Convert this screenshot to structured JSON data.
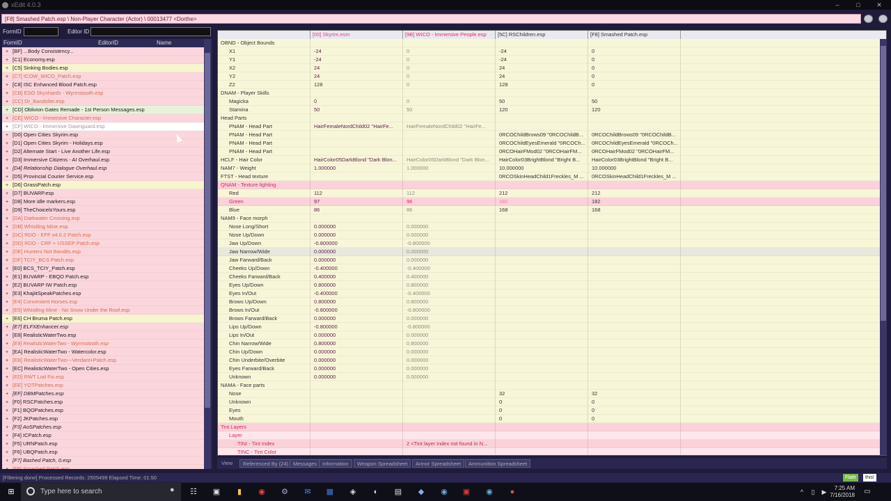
{
  "window": {
    "title": "xEdit 4.0.3",
    "path": "[F8] Smashed Patch.esp \\ Non-Player Character (Actor) \\ 00013477 <Dorthe>"
  },
  "filter": {
    "formid_label": "FormID",
    "editorid_label": "Editor ID"
  },
  "left": {
    "columns": [
      "FormID",
      "EditorID",
      "Name"
    ],
    "rows": [
      {
        "t": "[BF] ...Body Consistency...",
        "c": "r"
      },
      {
        "t": "[C1] Economy.esp",
        "c": "r"
      },
      {
        "t": "[C5] Sinking Bodies.esp",
        "c": "y"
      },
      {
        "t": "[C7] ICOW_WICO_Patch.esp",
        "c": "o"
      },
      {
        "t": "[C8] ISC Enhanced Blood Patch.esp",
        "c": "r"
      },
      {
        "t": "[CB] ESO Skyshards - Wyrmstooth.esp",
        "c": "o"
      },
      {
        "t": "[CC] Dr_Bandolier.esp",
        "c": "o"
      },
      {
        "t": "[CD] Oblivion Gates Remade - 1st Person Messages.esp",
        "c": "g"
      },
      {
        "t": "[CE] WICO - Immersive Character.esp",
        "c": "o"
      },
      {
        "t": "[CF] WICO - Immersive Dawnguard.esp",
        "c": "w"
      },
      {
        "t": "[D0] Open Cities Skyrim.esp",
        "c": "r"
      },
      {
        "t": "[D1] Open Cities Skyrim - Holidays.esp",
        "c": "r"
      },
      {
        "t": "[D2] Alternate Start - Live Another Life.esp",
        "c": "r"
      },
      {
        "t": "[D3] Immersive Citizens - AI Overhaul.esp",
        "c": "r"
      },
      {
        "t": "[D4] Relationship Dialogue Overhaul.esp",
        "c": "ri"
      },
      {
        "t": "[D5] Provincial Courier Service.esp",
        "c": "r"
      },
      {
        "t": "[D6] GrassPatch.esp",
        "c": "y"
      },
      {
        "t": "[D7] BUVARP.esp",
        "c": "r"
      },
      {
        "t": "[D8] More idle markers.esp",
        "c": "r"
      },
      {
        "t": "[D9] TheChoicelsYours.esp",
        "c": "r"
      },
      {
        "t": "[DA] Darkwater Crossing.esp",
        "c": "o"
      },
      {
        "t": "[DB] Whistling Mine.esp",
        "c": "o"
      },
      {
        "t": "[DC] RDO - EFF v4.0.2 Patch.esp",
        "c": "o"
      },
      {
        "t": "[DD] RDO - CRF + USSEP Patch.esp",
        "c": "o"
      },
      {
        "t": "[DE] Hunters Not Bandits.esp",
        "c": "o"
      },
      {
        "t": "[DF] TCIY_BCS Patch.esp",
        "c": "o"
      },
      {
        "t": "[E0] BCS_TCIY_Patch.esp",
        "c": "r"
      },
      {
        "t": "[E1] BUVARP - EBQO Patch.esp",
        "c": "r"
      },
      {
        "t": "[E2] BUVARP IW Patch.esp",
        "c": "r"
      },
      {
        "t": "[E3] KhajiitSpeakPatches.esp",
        "c": "r"
      },
      {
        "t": "[E4] Convenient Horses.esp",
        "c": "o"
      },
      {
        "t": "[E5] Whistling Mine - No Snow Under the Roof.esp",
        "c": "o"
      },
      {
        "t": "[E6] CH Bruma Patch.esp",
        "c": "y"
      },
      {
        "t": "[E7] ELFXEnhancer.esp",
        "c": "ri"
      },
      {
        "t": "[E8] RealisticWaterTwo.esp",
        "c": "r"
      },
      {
        "t": "[E9] RealisticWaterTwo - Wyrmstooth.esp",
        "c": "oi"
      },
      {
        "t": "[EA] RealisticWaterTwo - Watercolor.esp",
        "c": "r"
      },
      {
        "t": "[EB] RealisticWaterTwo---Verdant+Patch.esp",
        "c": "o"
      },
      {
        "t": "[EC] RealisticWaterTwo - Open Cities.esp",
        "c": "r"
      },
      {
        "t": "[ED] RWT Lod Fix.esp",
        "c": "o"
      },
      {
        "t": "[EE] YOTPatches.esp",
        "c": "o"
      },
      {
        "t": "[EF] DBMPatches.esp",
        "c": "ri"
      },
      {
        "t": "[F0] RSCPatches.esp",
        "c": "r"
      },
      {
        "t": "[F1] BQOPatches.esp",
        "c": "r"
      },
      {
        "t": "[F2] JKPatches.esp",
        "c": "r"
      },
      {
        "t": "[F3] AoSPatches.esp",
        "c": "ri"
      },
      {
        "t": "[F4] ICPatch.esp",
        "c": "r"
      },
      {
        "t": "[F5] URNPatch.esp",
        "c": "r"
      },
      {
        "t": "[F6] UBQPatch.esp",
        "c": "r"
      },
      {
        "t": "[F7] Bashed Patch, 0.esp",
        "c": "ri"
      },
      {
        "t": "[F8] Smashed Patch.esp",
        "c": "o"
      }
    ]
  },
  "grid": {
    "columns": [
      "",
      "[00] Skyrim.esm",
      "[9B] WICO - Immersive People.esp",
      "[5C] RSChildren.esp",
      "[F8] Smashed Patch.esp"
    ],
    "rows": [
      {
        "l": "OBND - Object Bounds",
        "lv": 0,
        "v": [
          "",
          "",
          "",
          ""
        ],
        "bg": "y"
      },
      {
        "l": "X1",
        "lv": 1,
        "v": [
          "-24",
          "0",
          "-24",
          "0"
        ],
        "bg": "y"
      },
      {
        "l": "Y1",
        "lv": 1,
        "v": [
          "-24",
          "0",
          "-24",
          "0"
        ],
        "bg": "y"
      },
      {
        "l": "X2",
        "lv": 1,
        "v": [
          "24",
          "0",
          "24",
          "0"
        ],
        "bg": "y"
      },
      {
        "l": "Y2",
        "lv": 1,
        "v": [
          "24",
          "0",
          "24",
          "0"
        ],
        "bg": "y"
      },
      {
        "l": "Z2",
        "lv": 1,
        "v": [
          "128",
          "0",
          "128",
          "0"
        ],
        "bg": "y"
      },
      {
        "l": "DNAM - Player Skills",
        "lv": 0,
        "v": [
          "",
          "",
          "",
          ""
        ],
        "bg": "y"
      },
      {
        "l": "Magicka",
        "lv": 1,
        "v": [
          "0",
          "0",
          "50",
          "50"
        ],
        "bg": "y"
      },
      {
        "l": "Stamina",
        "lv": 1,
        "v": [
          "50",
          "50",
          "120",
          "120"
        ],
        "bg": "y"
      },
      {
        "l": "Head Parts",
        "lv": 0,
        "v": [
          "",
          "",
          "",
          ""
        ],
        "bg": "y"
      },
      {
        "l": "PNAM - Head Part",
        "lv": 1,
        "v": [
          "HairFemaleNordChild02 \"HairFe...",
          "HairFemaleNordChild02 \"HairFe...",
          "",
          ""
        ],
        "bg": "y"
      },
      {
        "l": "PNAM - Head Part",
        "lv": 1,
        "v": [
          "",
          "",
          "0RCOChildBrows09 \"0RCOChildB...",
          "0RCOChildBrows09 \"0RCOChildB..."
        ],
        "bg": "y"
      },
      {
        "l": "PNAM - Head Part",
        "lv": 1,
        "v": [
          "",
          "",
          "0RCOChildEyesEmerald \"0RCOCh...",
          "0RCOChildEyesEmerald \"0RCOCh..."
        ],
        "bg": "y"
      },
      {
        "l": "PNAM - Head Part",
        "lv": 1,
        "v": [
          "",
          "",
          "0RCOHairFMod02 \"0RCOHairFM...",
          "0RCOHairFMod02 \"0RCOHairFM..."
        ],
        "bg": "y"
      },
      {
        "l": "HCLF - Hair Color",
        "lv": 0,
        "v": [
          "HairColor05DarkBlond \"Dark Blon...",
          "HairColor05DarkBlond \"Dark Blon...",
          "HairColor03BrightBlond \"Bright B...",
          "HairColor03BrightBlond \"Bright B..."
        ],
        "bg": "y"
      },
      {
        "l": "NAM7 - Weight",
        "lv": 0,
        "v": [
          "1.000000",
          "1.000000",
          "10.000000",
          "10.000000"
        ],
        "bg": "y"
      },
      {
        "l": "FTST - Head texture",
        "lv": 0,
        "v": [
          "",
          "",
          "0RCOSkinHeadChild1Freckles_M ...",
          "0RCOSkinHeadChild1Freckles_M ..."
        ],
        "bg": "y"
      },
      {
        "l": "QNAM - Texture lighting",
        "lv": 0,
        "v": [
          "",
          "",
          "",
          ""
        ],
        "bg": "p"
      },
      {
        "l": "Red",
        "lv": 1,
        "v": [
          "112",
          "112",
          "212",
          "212"
        ],
        "bg": "y"
      },
      {
        "l": "Green",
        "lv": 1,
        "v": [
          "97",
          "96",
          "182",
          "182"
        ],
        "bg": "p"
      },
      {
        "l": "Blue",
        "lv": 1,
        "v": [
          "86",
          "86",
          "168",
          "168"
        ],
        "bg": "y"
      },
      {
        "l": "NAM9 - Face morph",
        "lv": 0,
        "v": [
          "",
          "",
          "",
          ""
        ],
        "bg": "y"
      },
      {
        "l": "Nose Long/Short",
        "lv": 1,
        "v": [
          "0.000000",
          "0.000000",
          "",
          ""
        ],
        "bg": "y"
      },
      {
        "l": "Nose Up/Down",
        "lv": 1,
        "v": [
          "0.000000",
          "0.000000",
          "",
          ""
        ],
        "bg": "y"
      },
      {
        "l": "Jaw Up/Down",
        "lv": 1,
        "v": [
          "-0.800000",
          "-0.800000",
          "",
          ""
        ],
        "bg": "y"
      },
      {
        "l": "Jaw Narrow/Wide",
        "lv": 1,
        "v": [
          "0.000000",
          "0.000000",
          "",
          ""
        ],
        "bg": "s"
      },
      {
        "l": "Jaw Farward/Back",
        "lv": 1,
        "v": [
          "0.000000",
          "0.000000",
          "",
          ""
        ],
        "bg": "y"
      },
      {
        "l": "Cheeks Up/Down",
        "lv": 1,
        "v": [
          "-0.400000",
          "-0.400000",
          "",
          ""
        ],
        "bg": "y"
      },
      {
        "l": "Cheeks Farward/Back",
        "lv": 1,
        "v": [
          "0.400000",
          "0.400000",
          "",
          ""
        ],
        "bg": "y"
      },
      {
        "l": "Eyes Up/Down",
        "lv": 1,
        "v": [
          "0.800000",
          "0.800000",
          "",
          ""
        ],
        "bg": "y"
      },
      {
        "l": "Eyes In/Out",
        "lv": 1,
        "v": [
          "-0.400000",
          "-0.400000",
          "",
          ""
        ],
        "bg": "y"
      },
      {
        "l": "Brows Up/Down",
        "lv": 1,
        "v": [
          "0.800000",
          "0.800000",
          "",
          ""
        ],
        "bg": "y"
      },
      {
        "l": "Brows In/Out",
        "lv": 1,
        "v": [
          "-0.800000",
          "-0.800000",
          "",
          ""
        ],
        "bg": "y"
      },
      {
        "l": "Brows Farward/Back",
        "lv": 1,
        "v": [
          "0.000000",
          "0.000000",
          "",
          ""
        ],
        "bg": "y"
      },
      {
        "l": "Lips Up/Down",
        "lv": 1,
        "v": [
          "-0.800000",
          "-0.800000",
          "",
          ""
        ],
        "bg": "y"
      },
      {
        "l": "Lips In/Out",
        "lv": 1,
        "v": [
          "0.000000",
          "0.000000",
          "",
          ""
        ],
        "bg": "y"
      },
      {
        "l": "Chin Narrow/Wide",
        "lv": 1,
        "v": [
          "0.800000",
          "0.800000",
          "",
          ""
        ],
        "bg": "y"
      },
      {
        "l": "Chin Up/Down",
        "lv": 1,
        "v": [
          "0.000000",
          "0.000000",
          "",
          ""
        ],
        "bg": "y"
      },
      {
        "l": "Chin Underbite/Overbite",
        "lv": 1,
        "v": [
          "0.000000",
          "0.000000",
          "",
          ""
        ],
        "bg": "y"
      },
      {
        "l": "Eyes Farward/Back",
        "lv": 1,
        "v": [
          "0.000000",
          "0.000000",
          "",
          ""
        ],
        "bg": "y"
      },
      {
        "l": "Unknown",
        "lv": 1,
        "v": [
          "0.000000",
          "0.000000",
          "",
          ""
        ],
        "bg": "y"
      },
      {
        "l": "NAMA - Face parts",
        "lv": 0,
        "v": [
          "",
          "",
          "",
          ""
        ],
        "bg": "y"
      },
      {
        "l": "Nose",
        "lv": 1,
        "v": [
          "",
          "",
          "32",
          "32"
        ],
        "bg": "y"
      },
      {
        "l": "Unknown",
        "lv": 1,
        "v": [
          "",
          "",
          "0",
          "0"
        ],
        "bg": "y"
      },
      {
        "l": "Eyes",
        "lv": 1,
        "v": [
          "",
          "",
          "0",
          "0"
        ],
        "bg": "y"
      },
      {
        "l": "Mouth",
        "lv": 1,
        "v": [
          "",
          "",
          "0",
          "0"
        ],
        "bg": "y"
      },
      {
        "l": "Tint Layers",
        "lv": 0,
        "v": [
          "",
          "",
          "",
          ""
        ],
        "bg": "p"
      },
      {
        "l": "Layer",
        "lv": 1,
        "v": [
          "",
          "",
          "",
          ""
        ],
        "bg": "lp"
      },
      {
        "l": "TINI - Tint Index",
        "lv": 2,
        "v": [
          "",
          "2 <Tint layer index not found in N...",
          "",
          ""
        ],
        "bg": "p"
      },
      {
        "l": "TINC - Tint Color",
        "lv": 2,
        "v": [
          "",
          "",
          "",
          ""
        ],
        "bg": "lp"
      }
    ]
  },
  "tabs": [
    "View",
    "Referenced By (24)",
    "Messages",
    "Information",
    "Weapon Spreadsheet",
    "Armor Spreadsheet",
    "Ammunition Spreadsheet"
  ],
  "status": "[Filtering done]  Processed Records: 2505499  Elapsed Time: 01:50",
  "status_right": {
    "left": "Flattr",
    "right": "this!"
  },
  "taskbar": {
    "search": "Type here to search",
    "time": "7:25 AM",
    "date": "7/16/2018"
  },
  "colors": {
    "row_red": "#fbd6dd",
    "row_yellow": "#f8f4cf",
    "row_green": "#e7f3d9",
    "row_white": "#ffffff",
    "grid_pink": "#fbd2da",
    "grid_yellow": "#f8f6d8",
    "accent": "#e42b6a"
  }
}
